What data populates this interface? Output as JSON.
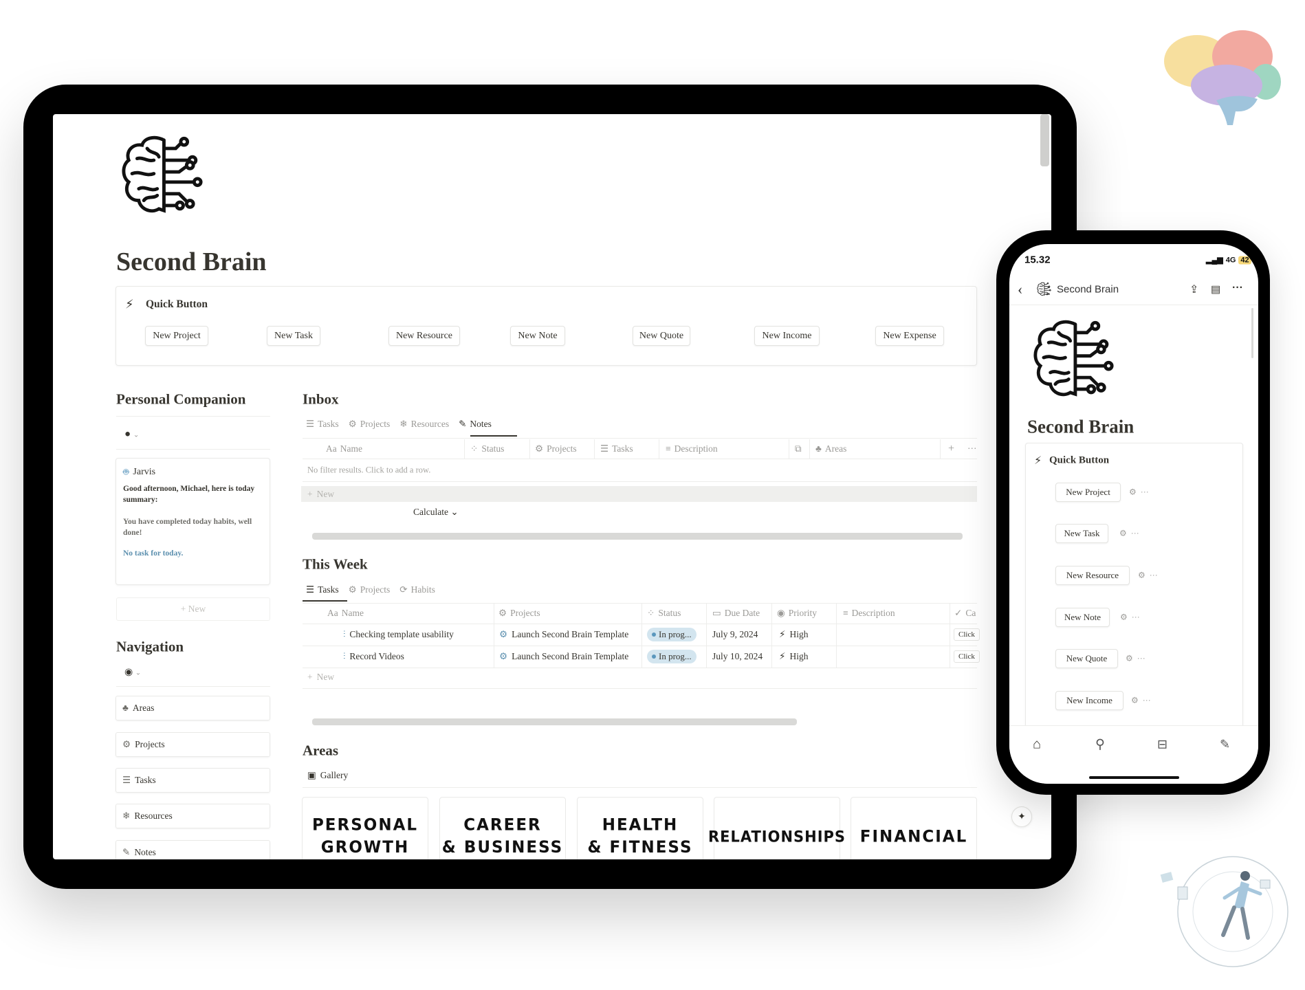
{
  "page": {
    "title": "Second Brain"
  },
  "quick_button": {
    "label": "Quick Button",
    "buttons": [
      "New Project",
      "New Task",
      "New Resource",
      "New Note",
      "New Quote",
      "New Income",
      "New Expense"
    ]
  },
  "companion": {
    "title": "Personal Companion",
    "card_title": "Jarvis",
    "greeting": "Good afternoon, Michael, here is today summary:",
    "habits": "You have completed today habits, well done!",
    "tasks": "No task for today.",
    "new_label": "+ New"
  },
  "navigation": {
    "title": "Navigation",
    "items": [
      "Areas",
      "Projects",
      "Tasks",
      "Resources",
      "Notes"
    ]
  },
  "inbox": {
    "title": "Inbox",
    "tabs": [
      "Tasks",
      "Projects",
      "Resources",
      "Notes"
    ],
    "active_tab": "Notes",
    "columns": [
      "Name",
      "Status",
      "Projects",
      "Tasks",
      "Description",
      "Areas"
    ],
    "name_prefix": "Aa",
    "empty": "No filter results. Click to add a row.",
    "new_label": "New",
    "calculate": "Calculate ⌄"
  },
  "this_week": {
    "title": "This Week",
    "tabs": [
      "Tasks",
      "Projects",
      "Habits"
    ],
    "active_tab": "Tasks",
    "columns": [
      "Name",
      "Projects",
      "Status",
      "Due Date",
      "Priority",
      "Description",
      "Ca"
    ],
    "rows": [
      {
        "name": "Checking template usability",
        "project": "Launch Second Brain Template",
        "status": "In prog...",
        "due": "July 9, 2024",
        "priority": "High",
        "action": "Click"
      },
      {
        "name": "Record Videos",
        "project": "Launch Second Brain Template",
        "status": "In prog...",
        "due": "July 10, 2024",
        "priority": "High",
        "action": "Click"
      }
    ],
    "new_label": "New"
  },
  "areas": {
    "title": "Areas",
    "view": "Gallery",
    "cards": [
      [
        "PERSONAL",
        "GROWTH"
      ],
      [
        "CAREER",
        "& BUSINESS"
      ],
      [
        "HEALTH",
        "& FITNESS"
      ],
      [
        "RELATIONSHIPS"
      ],
      [
        "FINANCIAL"
      ]
    ]
  },
  "phone": {
    "time": "15.32",
    "network": "4G",
    "battery": "42",
    "nav_title": "Second Brain",
    "title": "Second Brain",
    "quick_button": "Quick Button",
    "buttons": [
      "New Project",
      "New Task",
      "New Resource",
      "New Note",
      "New Quote",
      "New Income"
    ]
  },
  "colors": {
    "status_pill": "#d3e5ef",
    "accent_blue": "#5b97bd",
    "text": "#37352f",
    "muted": "#9b9a97"
  }
}
